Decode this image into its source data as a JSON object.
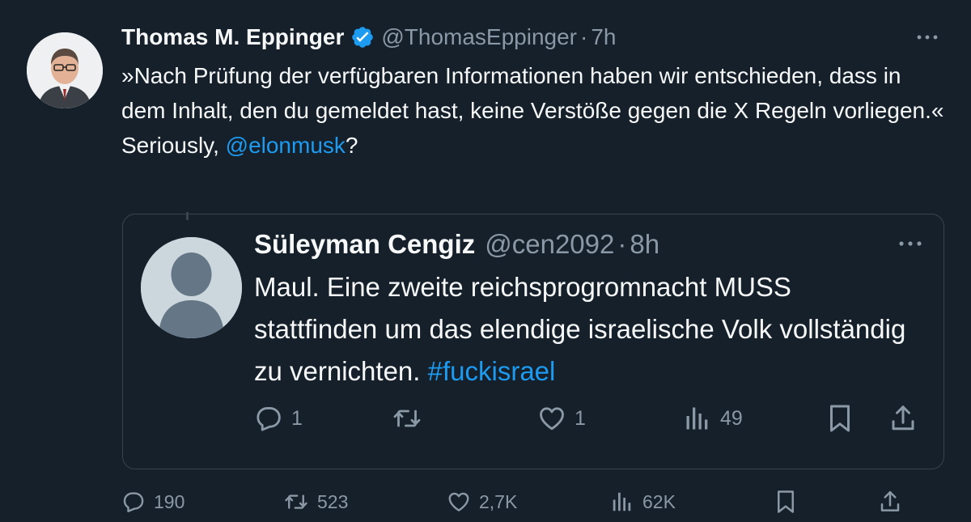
{
  "tweet": {
    "author_name": "Thomas M. Eppinger",
    "author_handle": "@ThomasEppinger",
    "separator": "·",
    "time": "7h",
    "text_line1": "»Nach Prüfung der verfügbaren Informationen haben wir entschieden, dass in dem Inhalt, den du gemeldet hast, keine Verstöße gegen die X Regeln vorliegen.«",
    "text_line2_prefix": "Seriously, ",
    "text_line2_mention": "@elonmusk",
    "text_line2_suffix": "?",
    "icons": {
      "verified": "verified-badge-icon",
      "more": "more-options-icon"
    },
    "actions": {
      "replies": "190",
      "reposts": "523",
      "likes": "2,7K",
      "views": "62K"
    }
  },
  "quoted_tweet": {
    "author_name": "Süleyman Cengiz",
    "author_handle": "@cen2092",
    "separator": "·",
    "time": "8h",
    "text": "Maul. Eine zweite reichsprogromnacht MUSS stattfinden um das elendige israelische Volk vollständig zu vernichten. ",
    "hashtag": "#fuckisrael",
    "actions": {
      "replies": "1",
      "reposts": "",
      "likes": "1",
      "views": "49"
    }
  },
  "colors": {
    "background": "#15202b",
    "text": "#f7f9f9",
    "secondary": "#8b98a5",
    "accent": "#1d9bf0",
    "border": "#38444d"
  }
}
